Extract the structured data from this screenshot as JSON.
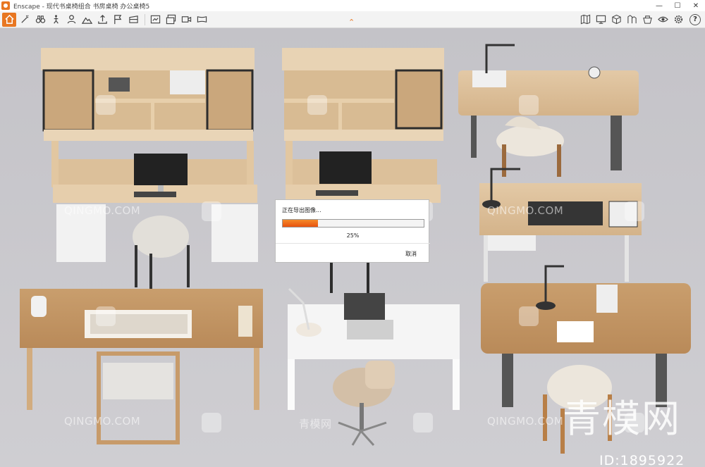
{
  "window": {
    "title": "Enscape - 现代书桌椅组合 书房桌椅 办公桌椅5",
    "controls": {
      "minimize": "—",
      "maximize": "☐",
      "close": "✕"
    }
  },
  "toolbar": {
    "left_icons": [
      "home-icon",
      "wand-icon",
      "binoculars-icon",
      "walk-icon",
      "person-icon",
      "mountain-icon",
      "upload-icon",
      "flag-icon",
      "bookmark-icon",
      "render-screenshot-icon",
      "render-batch-icon",
      "render-video-icon",
      "render-panorama-icon"
    ],
    "right_icons": [
      "map-icon",
      "monitor-icon",
      "cube-icon",
      "asset-library-icon",
      "material-icon",
      "eye-icon",
      "settings-icon"
    ],
    "help_label": "?",
    "collapse_glyph": "⌃",
    "accent_color": "#e87722"
  },
  "dialog": {
    "title": "正在导出图像...",
    "progress": 0.25,
    "percent_label": "25%",
    "cancel_label": "取消"
  },
  "watermarks": {
    "site_text": "QINGMO.COM",
    "cn_text": "青模网",
    "big_text": "青模网",
    "id_text": "ID:1895922"
  }
}
